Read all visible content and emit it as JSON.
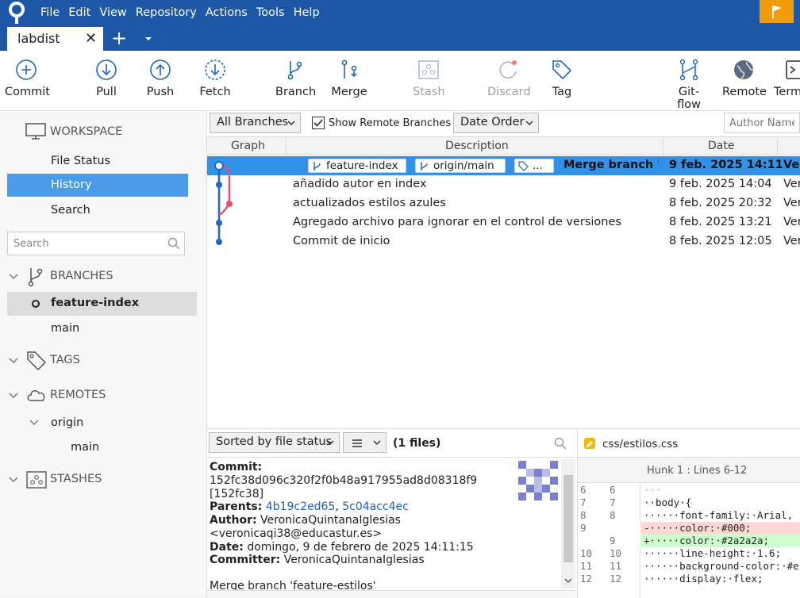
{
  "menu": {
    "items": [
      "File",
      "Edit",
      "View",
      "Repository",
      "Actions",
      "Tools",
      "Help"
    ]
  },
  "tab": {
    "label": "labdist"
  },
  "toolbar": {
    "commit": "Commit",
    "pull": "Pull",
    "push": "Push",
    "fetch": "Fetch",
    "branch": "Branch",
    "merge": "Merge",
    "stash": "Stash",
    "discard": "Discard",
    "tag": "Tag",
    "gitflow": "Git-flow",
    "remote": "Remote",
    "terminal": "Term"
  },
  "sidebar": {
    "workspace": "WORKSPACE",
    "file_status": "File Status",
    "history": "History",
    "search": "Search",
    "search_placeholder": "Search",
    "branches": "BRANCHES",
    "branch_items": [
      "feature-index",
      "main"
    ],
    "tags": "TAGS",
    "remotes": "REMOTES",
    "remote_origin": "origin",
    "remote_branch": "main",
    "stashes": "STASHES"
  },
  "filters": {
    "branches": "All Branches",
    "show_remote": "Show Remote Branches",
    "order": "Date Order",
    "author_placeholder": "Author Name"
  },
  "columns": {
    "graph": "Graph",
    "description": "Description",
    "date": "Date"
  },
  "commits": [
    {
      "desc": "Merge branch 'fe",
      "date": "9 feb. 2025 14:11",
      "author": "Ver",
      "tags": [
        "feature-index",
        "origin/main",
        "..."
      ]
    },
    {
      "desc": "añadido autor en index",
      "date": "9 feb. 2025 14:04",
      "author": "Ver"
    },
    {
      "desc": "actualizados estilos azules",
      "date": "8 feb. 2025 20:32",
      "author": "Ver"
    },
    {
      "desc": "Agregado archivo para ignorar en el control de versiones",
      "date": "8 feb. 2025 13:21",
      "author": "Ver"
    },
    {
      "desc": "Commit de inicio",
      "date": "8 feb. 2025 12:05",
      "author": "Ver"
    }
  ],
  "files_panel": {
    "sort": "Sorted by file status",
    "count": "(1 files)"
  },
  "commit_info": {
    "commit_label": "Commit:",
    "hash": "152fc38d096c320f2f0b48a917955ad8d08318f9",
    "short": "[152fc38]",
    "parents_label": "Parents:",
    "parent1": "4b19c2ed65",
    "parent_sep": ",",
    "parent2": "5c04acc4ec",
    "author_label": "Author:",
    "author": "VeronicaQuintanaIglesias",
    "email": "<veronicaqi38@educastur.es>",
    "date_label": "Date:",
    "date": "domingo, 9 de febrero de 2025 14:11:15",
    "committer_label": "Committer:",
    "committer": "VeronicaQuintanaIglesias",
    "message": "Merge branch 'feature-estilos'"
  },
  "diff": {
    "file": "css/estilos.css",
    "hunk": "Hunk 1 : Lines 6-12",
    "lines": [
      {
        "o": "6",
        "n": "6",
        "t": "···"
      },
      {
        "o": "7",
        "n": "7",
        "t": "··body·{"
      },
      {
        "o": "8",
        "n": "8",
        "t": "······font-family:·Arial,"
      },
      {
        "o": "9",
        "n": "",
        "t": "-·····color:·#000;"
      },
      {
        "o": "",
        "n": "9",
        "t": "+·····color:·#2a2a2a;"
      },
      {
        "o": "10",
        "n": "10",
        "t": "······line-height:·1.6;"
      },
      {
        "o": "11",
        "n": "11",
        "t": "······background-color:·#e"
      },
      {
        "o": "12",
        "n": "12",
        "t": "······display:·flex;"
      }
    ]
  },
  "colors": {
    "accent": "#1d57a6",
    "selection": "#3292ea",
    "branch_blue": "#1f67c0",
    "branch_pink": "#e0506e",
    "added": "#ccffcc",
    "removed": "#ffd7d7",
    "flag": "#f39c0b"
  }
}
